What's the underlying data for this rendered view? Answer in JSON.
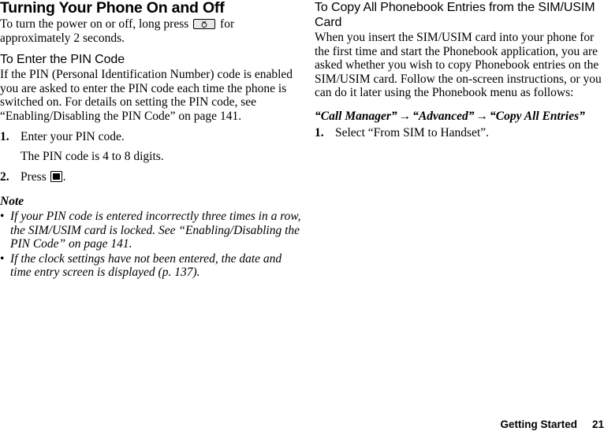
{
  "document": {
    "type": "mobile-phone-user-guide-page",
    "page_number": "21",
    "section_name": "Getting Started"
  },
  "left_column": {
    "title": "Turning Your Phone On and Off",
    "intro_before_key": "To turn the power on or off, long press ",
    "intro_after_key": " for approximately 2 seconds.",
    "power_key_icon": "power-key-icon",
    "subsection_title": "To Enter the PIN Code",
    "subsection_body": "If the PIN (Personal Identification Number) code is enabled you are asked to enter the PIN code each time the phone is switched on. For details on setting the PIN code, see “Enabling/Disabling the PIN Code” on page 141.",
    "steps": [
      {
        "num": "1.",
        "text": "Enter your PIN code."
      },
      {
        "num": "2.",
        "text_before_key": "Press ",
        "text_after_key": ".",
        "center_key_icon": "center-select-key-icon"
      }
    ],
    "step1_note": "The PIN code is 4 to 8 digits.",
    "note_heading": "Note",
    "note_items": [
      "If your PIN code is entered incorrectly three times in a row, the SIM/USIM card is locked. See “Enabling/Disabling the PIN Code” on page 141.",
      "If the clock settings have not been entered, the date and time entry screen is displayed (p. 137)."
    ],
    "bullet_glyph": "•"
  },
  "right_column": {
    "subsection_title": "To Copy All Phonebook Entries from the SIM/USIM Card",
    "body": "When you insert the SIM/USIM card into your phone for the first time and start the Phonebook application, you are asked whether you wish to copy Phonebook entries on the SIM/USIM card. Follow the on-screen instructions, or you can do it later using the Phonebook menu as follows:",
    "menu_path": {
      "item1": "“Call Manager”",
      "arrow1": "→",
      "item2": "“Advanced”",
      "arrow2": "→",
      "item3": "“Copy All Entries”"
    },
    "steps": [
      {
        "num": "1.",
        "text": "Select “From SIM to Handset”."
      }
    ]
  },
  "footer": {
    "section_label": "Getting Started",
    "page_label": "21"
  },
  "colors": {
    "text": "#000000",
    "background": "#ffffff",
    "key_face": "#e9e9e9",
    "key_border": "#000000"
  }
}
